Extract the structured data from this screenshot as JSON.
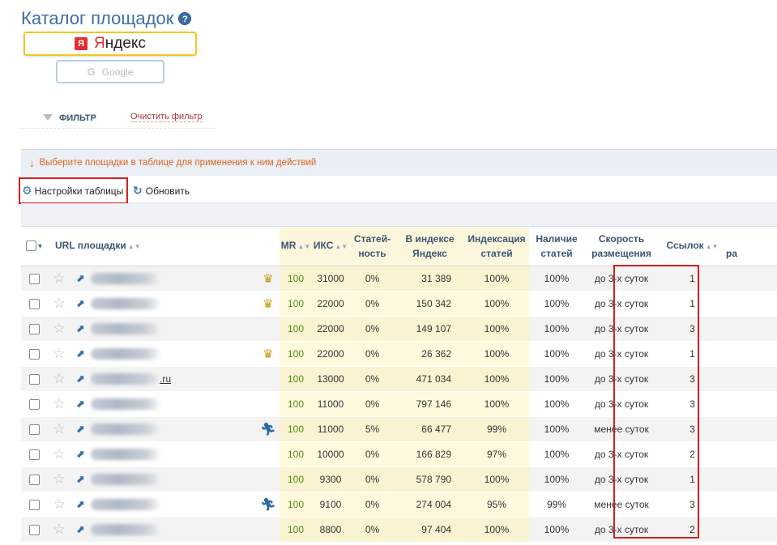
{
  "page": {
    "title": "Каталог площадок",
    "help_glyph": "?"
  },
  "engines": {
    "yandex": {
      "logo_letter": "Я",
      "first_letter": "Я",
      "rest": "ндекс"
    },
    "google": {
      "logo_letter": "G",
      "label": "Google"
    }
  },
  "filter": {
    "label": "ФИЛЬТР",
    "clear_label": "Очистить фильтр"
  },
  "info": {
    "arrow": "↓",
    "text": "Выберите площадки в таблице для применения к ним действий"
  },
  "toolbar": {
    "settings_label": "Настройки таблицы",
    "refresh_label": "Обновить"
  },
  "table": {
    "headers": {
      "url": "URL площадки",
      "mr": "MR",
      "iks": "ИКС",
      "stat_l1": "Статей-",
      "stat_l2": "ность",
      "index_l1": "В индексе",
      "index_l2": "Яндекс",
      "indexing_l1": "Индексация",
      "indexing_l2": "статей",
      "avail_l1": "Наличие",
      "avail_l2": "статей",
      "speed_l1": "Скорость",
      "speed_l2": "размещения",
      "links": "Ссылок",
      "extra": "ра"
    },
    "rows": [
      {
        "badge": "crown",
        "url_suffix": "",
        "mr": "100",
        "iks": "31000",
        "statnost": "0%",
        "index": "31 389",
        "indexing": "100%",
        "avail": "100%",
        "speed": "до 3-х суток",
        "links": "1"
      },
      {
        "badge": "crown",
        "url_suffix": "",
        "mr": "100",
        "iks": "22000",
        "statnost": "0%",
        "index": "150 342",
        "indexing": "100%",
        "avail": "100%",
        "speed": "до 3-х суток",
        "links": "1"
      },
      {
        "badge": "",
        "url_suffix": "",
        "mr": "100",
        "iks": "22000",
        "statnost": "0%",
        "index": "149 107",
        "indexing": "100%",
        "avail": "100%",
        "speed": "до 3-х суток",
        "links": "3"
      },
      {
        "badge": "crown",
        "url_suffix": "",
        "mr": "100",
        "iks": "22000",
        "statnost": "0%",
        "index": "26 362",
        "indexing": "100%",
        "avail": "100%",
        "speed": "до 3-х суток",
        "links": "1"
      },
      {
        "badge": "",
        "url_suffix": ".ru",
        "mr": "100",
        "iks": "13000",
        "statnost": "0%",
        "index": "471 034",
        "indexing": "100%",
        "avail": "100%",
        "speed": "до 3-х суток",
        "links": "3"
      },
      {
        "badge": "",
        "url_suffix": "",
        "mr": "100",
        "iks": "11000",
        "statnost": "0%",
        "index": "797 146",
        "indexing": "100%",
        "avail": "100%",
        "speed": "до 3-х суток",
        "links": "3"
      },
      {
        "badge": "runner",
        "url_suffix": "",
        "mr": "100",
        "iks": "11000",
        "statnost": "5%",
        "index": "66 477",
        "indexing": "99%",
        "avail": "100%",
        "speed": "менее суток",
        "links": "3"
      },
      {
        "badge": "",
        "url_suffix": "",
        "mr": "100",
        "iks": "10000",
        "statnost": "0%",
        "index": "166 829",
        "indexing": "97%",
        "avail": "100%",
        "speed": "до 3-х суток",
        "links": "2"
      },
      {
        "badge": "",
        "url_suffix": "",
        "mr": "100",
        "iks": "9300",
        "statnost": "0%",
        "index": "578 790",
        "indexing": "100%",
        "avail": "100%",
        "speed": "до 3-х суток",
        "links": "1"
      },
      {
        "badge": "runner",
        "url_suffix": "",
        "mr": "100",
        "iks": "9100",
        "statnost": "0%",
        "index": "274 004",
        "indexing": "95%",
        "avail": "99%",
        "speed": "менее суток",
        "links": "3"
      },
      {
        "badge": "",
        "url_suffix": "",
        "mr": "100",
        "iks": "8800",
        "statnost": "0%",
        "index": "97 404",
        "indexing": "100%",
        "avail": "100%",
        "speed": "до 3-х суток",
        "links": "2"
      }
    ]
  },
  "icons": {
    "star": "☆",
    "external": "⬈",
    "crown": "♛",
    "runner": "🏃︎",
    "gear": "⚙",
    "refresh": "↻",
    "sort": "▲▼",
    "header_caret": "▾"
  },
  "colors": {
    "accent": "#3a6fa5",
    "highlight_red": "#d32020",
    "mr_green": "#4f8d12",
    "yandex_yellow": "#f2c81c",
    "info_orange": "#e06422"
  }
}
